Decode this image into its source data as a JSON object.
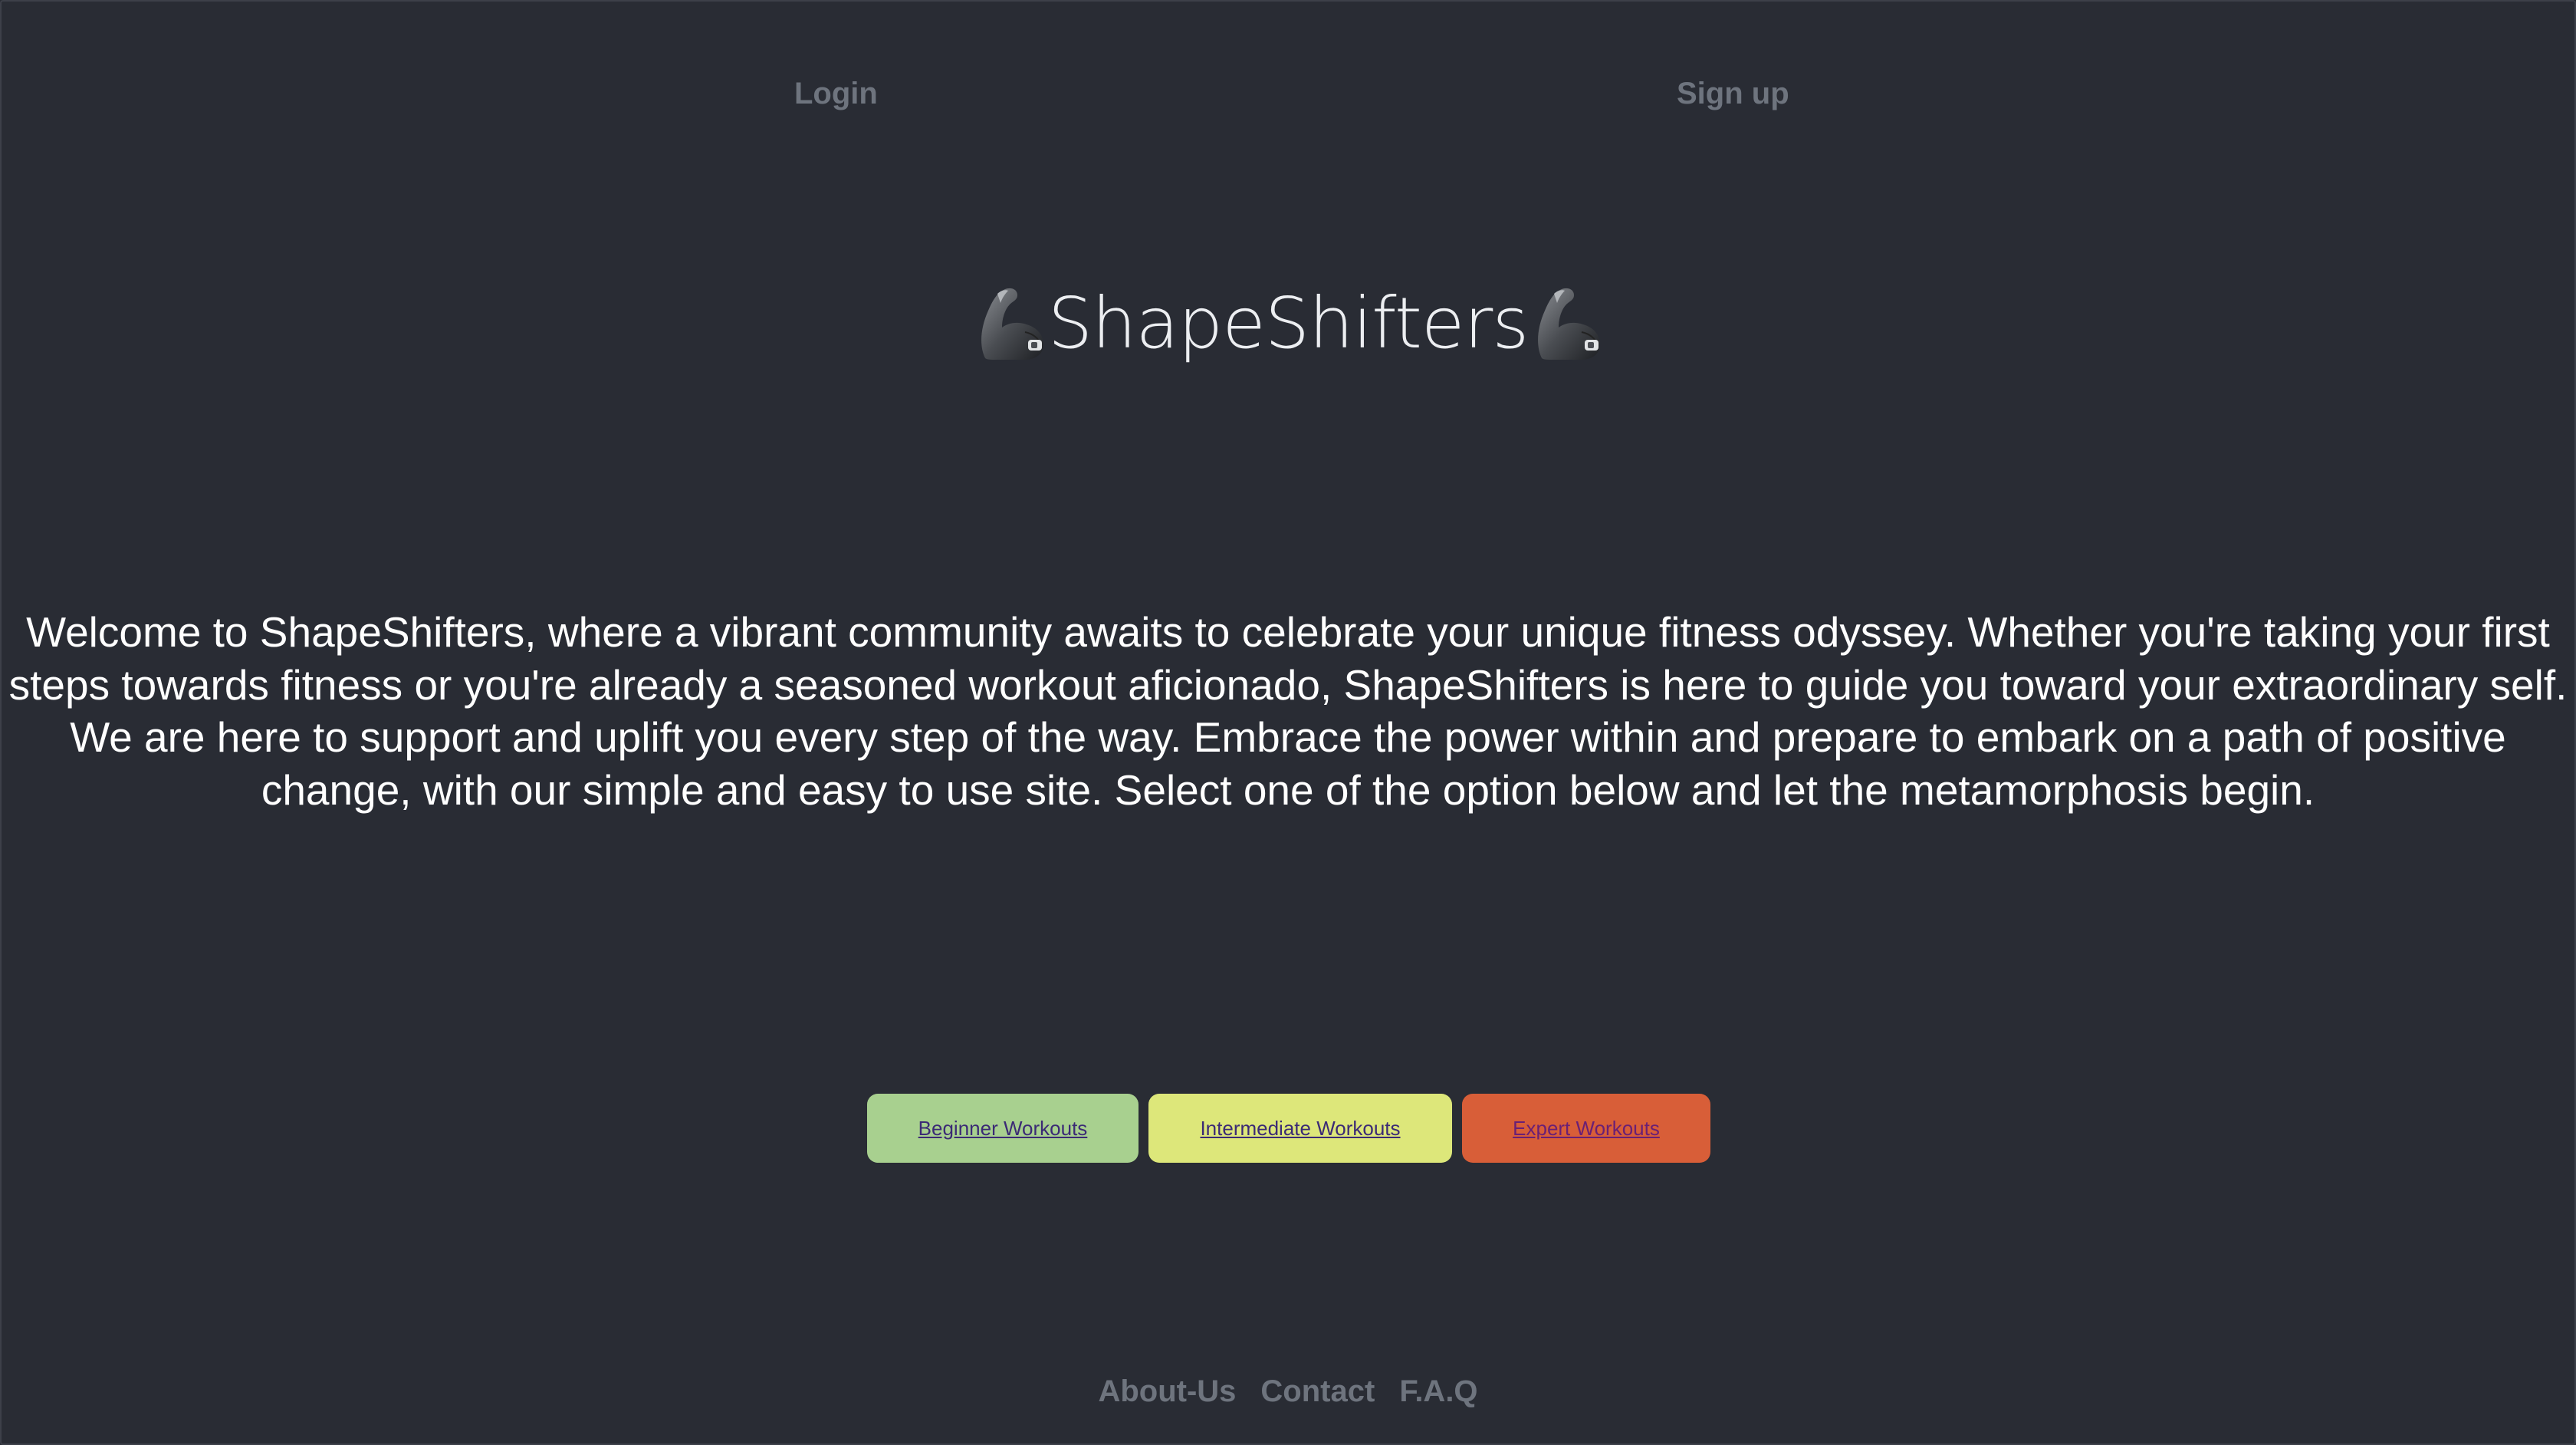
{
  "header": {
    "login_label": "Login",
    "signup_label": "Sign up"
  },
  "brand": {
    "title": "ShapeShifters",
    "icon": "flexed-biceps-icon"
  },
  "intro": {
    "text": "Welcome to ShapeShifters, where a vibrant community awaits to celebrate your unique fitness odyssey. Whether you're taking your first steps towards fitness or you're already a seasoned workout aficionado, ShapeShifters is here to guide you toward your extraordinary self. We are here to support and uplift you every step of the way. Embrace the power within and prepare to embark on a path of positive change, with our simple and easy to use site. Select one of the option below and let the metamorphosis begin."
  },
  "workouts": {
    "beginner_label": "Beginner Workouts",
    "intermediate_label": "Intermediate Workouts",
    "expert_label": "Expert Workouts",
    "beginner_color": "#a8d08f",
    "intermediate_color": "#dde77a",
    "expert_color": "#d85e38"
  },
  "footer": {
    "about_label": "About-Us",
    "contact_label": "Contact",
    "faq_label": "F.A.Q"
  },
  "colors": {
    "background": "#292c34",
    "nav_text": "#6e747e",
    "body_text": "#ffffff"
  }
}
